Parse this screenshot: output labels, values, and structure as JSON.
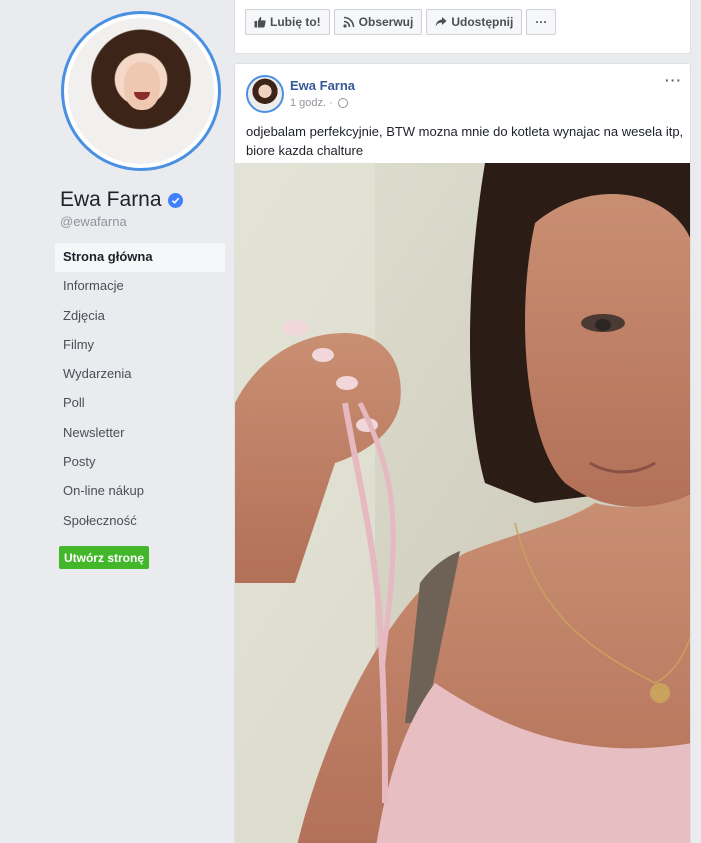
{
  "page": {
    "name": "Ewa Farna",
    "handle": "@ewafarna"
  },
  "sidebar": {
    "items": [
      {
        "label": "Strona główna",
        "active": true
      },
      {
        "label": "Informacje"
      },
      {
        "label": "Zdjęcia"
      },
      {
        "label": "Filmy"
      },
      {
        "label": "Wydarzenia"
      },
      {
        "label": "Poll"
      },
      {
        "label": "Newsletter"
      },
      {
        "label": "Posty"
      },
      {
        "label": "On-line nákup"
      },
      {
        "label": "Społeczność"
      }
    ],
    "create_page_label": "Utwórz stronę"
  },
  "actions": {
    "like_label": "Lubię to!",
    "follow_label": "Obserwuj",
    "share_label": "Udostępnij",
    "more_label": "···"
  },
  "post": {
    "author": "Ewa Farna",
    "time": "1 godz. ·",
    "text": "odjebalam perfekcyjnie, BTW mozna mnie do kotleta wynajac na wesela itp, biore kazda chalture",
    "more_label": "···"
  },
  "colors": {
    "accent": "#4080ff",
    "link": "#365899",
    "create_button": "#42b72a",
    "background": "#e9ebee"
  }
}
